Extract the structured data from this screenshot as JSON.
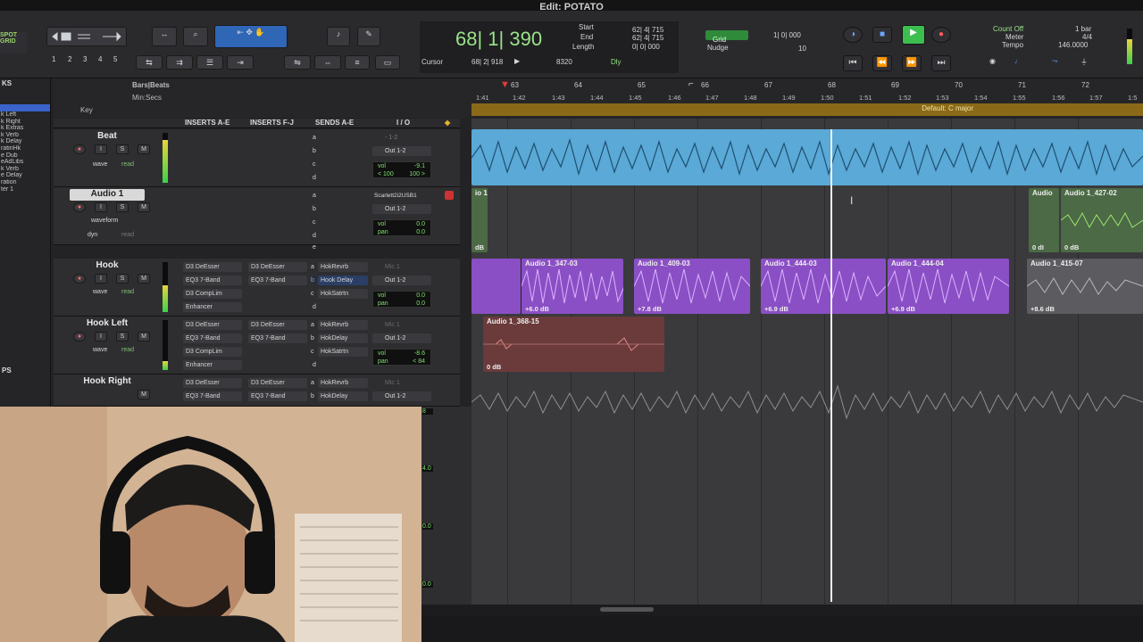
{
  "window": {
    "title": "Edit: POTATO"
  },
  "toolbar": {
    "edit_mode_1": "SPOT",
    "edit_mode_2": "GRID",
    "zoom_presets": [
      "1",
      "2",
      "3",
      "4",
      "5"
    ],
    "counter_main": "68| 1| 390",
    "start_label": "Start",
    "end_label": "End",
    "length_label": "Length",
    "start_value": "62| 4| 715",
    "end_value": "62| 4| 715",
    "length_value": "0| 0| 000",
    "cursor_label": "Cursor",
    "cursor_value": "68| 2| 918",
    "sample_value": "8320",
    "dly_label": "Dly",
    "grid_label": "Grid",
    "grid_value": "1| 0| 000",
    "nudge_label": "Nudge",
    "nudge_value": "10",
    "count_off": "Count Off",
    "meter_label": "Meter",
    "tempo_label": "Tempo",
    "bar_count": "1 bar",
    "meter_value": "4/4",
    "tempo_value": "146.0000"
  },
  "tracklist": {
    "header": "KS",
    "items": [
      "",
      "k Left",
      "k Right",
      "k Extras",
      "k Verb",
      "k Delay",
      "ratinHk",
      "e Dub",
      "eAdLibs",
      "k Verb",
      "e Delay",
      "ration",
      "ter 1"
    ],
    "groups_header": "PS"
  },
  "rulers": {
    "bars_label": "Bars|Beats",
    "min_label": "Min:Secs",
    "key_label": "Key",
    "bars": [
      "63",
      "64",
      "65",
      "66",
      "67",
      "68",
      "69",
      "70",
      "71",
      "72"
    ],
    "times": [
      "1:41",
      "1:42",
      "1:43",
      "1:44",
      "1:45",
      "1:46",
      "1:47",
      "1:48",
      "1:49",
      "1:50",
      "1:51",
      "1:52",
      "1:53",
      "1:54",
      "1:55",
      "1:56",
      "1:57",
      "1:5"
    ],
    "key_text": "Default: C major"
  },
  "columns": {
    "inserts_ae": "INSERTS A-E",
    "inserts_fj": "INSERTS F-J",
    "sends_ae": "SENDS A-E",
    "io": "I / O"
  },
  "tracks": [
    {
      "name": "Beat",
      "view": "wave",
      "auto": "read",
      "sends": [
        "a",
        "b",
        "c",
        "d"
      ],
      "input": "- 1-2",
      "output": "Out 1-2",
      "vol_label": "vol",
      "vol": "-9.1",
      "pan_l": "< 100",
      "pan_r": "100 >"
    },
    {
      "name": "Audio 1",
      "view": "waveform",
      "auto": "dyn",
      "auto2": "read",
      "sends": [
        "a",
        "b",
        "c",
        "d",
        "e"
      ],
      "input": "Scarlett2i2USB1",
      "output": "Out 1-2",
      "vol_label": "vol",
      "vol": "0.0",
      "pan_label": "pan",
      "pan": "0.0"
    },
    {
      "name": "Hook",
      "view": "wave",
      "auto": "read",
      "inserts_a": [
        "D3 DeEsser",
        "EQ3 7-Band",
        "D3 CompLim",
        "Enhancer"
      ],
      "inserts_f": [
        "D3 DeEsser",
        "EQ3 7-Band"
      ],
      "sends": [
        "HokRevrb",
        "Hook Delay",
        "HokSatrtn",
        "d"
      ],
      "send_letters": [
        "a",
        "b",
        "c",
        ""
      ],
      "input": "Mic 1",
      "output": "Out 1-2",
      "vol_label": "vol",
      "vol": "0.0",
      "pan_label": "pan",
      "pan": "0.0"
    },
    {
      "name": "Hook Left",
      "view": "wave",
      "auto": "read",
      "inserts_a": [
        "D3 DeEsser",
        "EQ3 7-Band",
        "D3 CompLim",
        "Enhancer"
      ],
      "inserts_f": [
        "D3 DeEsser",
        "EQ3 7-Band"
      ],
      "sends": [
        "HokRevrb",
        "HokDelay",
        "HokSatrtn",
        "d"
      ],
      "send_letters": [
        "a",
        "b",
        "c",
        ""
      ],
      "input": "Mic 1",
      "output": "Out 1-2",
      "vol_label": "vol",
      "vol": "-8.6",
      "pan_label": "pan",
      "pan": "< 84"
    },
    {
      "name": "Hook Right",
      "inserts_a": [
        "D3 DeEsser",
        "EQ3 7-Band"
      ],
      "inserts_f": [
        "D3 DeEsser",
        "EQ3 7-Band"
      ],
      "sends": [
        "HokRevrb",
        "HokDelay"
      ],
      "send_letters": [
        "a",
        "b"
      ],
      "input": "Mic 1",
      "output": "Out 1-2"
    }
  ],
  "partial_values": [
    "8",
    "4.0",
    "0.0",
    "0.0"
  ],
  "clips": [
    {
      "label": "io 1",
      "gain": "dB"
    },
    {
      "label": "Audio",
      "gain": "0 dI"
    },
    {
      "label": "Audio 1_427-02",
      "gain": "0 dB"
    },
    {
      "label": "Audio 1_347-03",
      "gain": "+6.0 dB"
    },
    {
      "label": "Audio 1_409-03",
      "gain": "+7.8 dB"
    },
    {
      "label": "Audio 1_444-03",
      "gain": "+6.9 dB"
    },
    {
      "label": "Audio 1_444-04",
      "gain": "+6.9 dB"
    },
    {
      "label": "Audio 1_415-07",
      "gain": "+8.6 dB"
    },
    {
      "label": "Audio 1_368-15",
      "gain": "0 dB"
    }
  ],
  "colors": {
    "beat": "#5aa9d6",
    "hook": "#8a4fc4",
    "audio1": "#4f8a44",
    "hookleft": "#6b3a3a",
    "meter": "#3ed04b"
  }
}
